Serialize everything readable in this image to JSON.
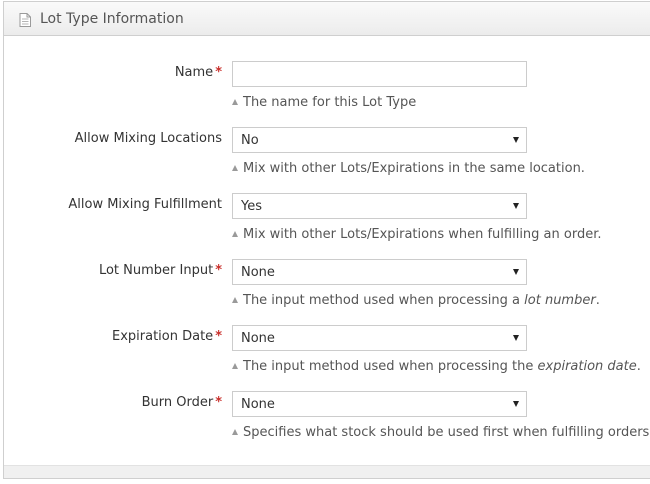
{
  "panel": {
    "title": "Lot Type Information",
    "icon": "document-icon"
  },
  "fields": {
    "name": {
      "label": "Name",
      "required": "*",
      "value": "",
      "placeholder": "",
      "help": "The name for this Lot Type"
    },
    "allow_mixing_locations": {
      "label": "Allow Mixing Locations",
      "value": "No",
      "help": "Mix with other Lots/Expirations in the same location."
    },
    "allow_mixing_fulfillment": {
      "label": "Allow Mixing Fulfillment",
      "value": "Yes",
      "help": "Mix with other Lots/Expirations when fulfilling an order."
    },
    "lot_number_input": {
      "label": "Lot Number Input",
      "required": "*",
      "value": "None",
      "help_prefix": "The input method used when processing a ",
      "help_emph": "lot number",
      "help_suffix": "."
    },
    "expiration_date": {
      "label": "Expiration Date",
      "required": "*",
      "value": "None",
      "help_prefix": "The input method used when processing the ",
      "help_emph": "expiration date",
      "help_suffix": "."
    },
    "burn_order": {
      "label": "Burn Order",
      "required": "*",
      "value": "None",
      "help": "Specifies what stock should be used first when fulfilling orders."
    }
  }
}
